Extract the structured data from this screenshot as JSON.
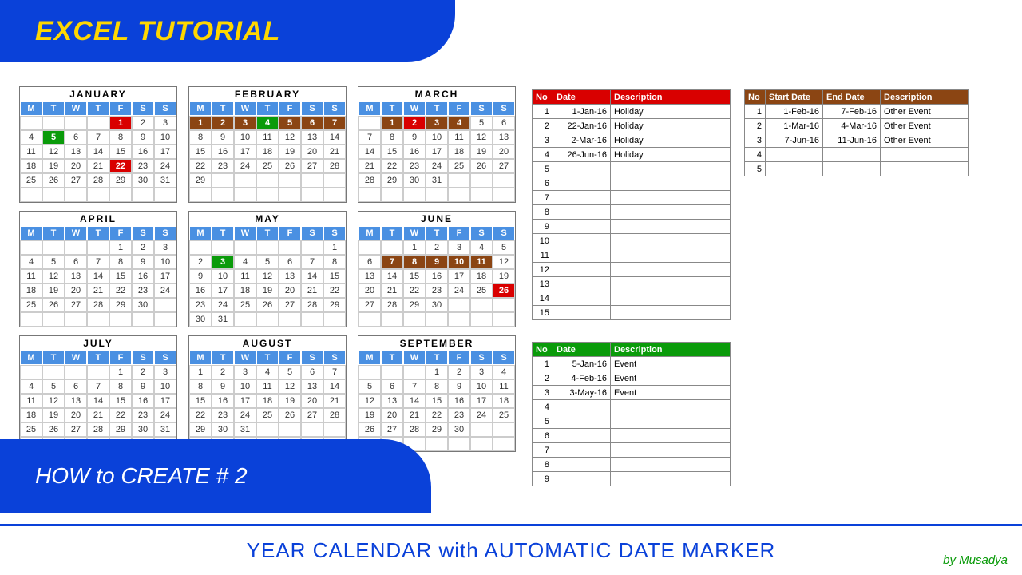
{
  "banner_title": "EXCEL TUTORIAL",
  "mid_title": "HOW to CREATE # 2",
  "footer_title": "YEAR CALENDAR with AUTOMATIC DATE MARKER",
  "author_text": "by Musadya",
  "dow": [
    "M",
    "T",
    "W",
    "T",
    "F",
    "S",
    "S"
  ],
  "months": [
    {
      "name": "JANUARY",
      "start": 4,
      "days": 31,
      "marks": {
        "1": "red",
        "5": "green",
        "22": "red"
      }
    },
    {
      "name": "FEBRUARY",
      "start": 0,
      "days": 29,
      "marks": {
        "1": "brown",
        "2": "brown",
        "3": "brown",
        "4": "green",
        "5": "brown",
        "6": "brown",
        "7": "brown"
      }
    },
    {
      "name": "MARCH",
      "start": 1,
      "days": 31,
      "marks": {
        "1": "brown",
        "2": "red",
        "3": "brown",
        "4": "brown"
      }
    },
    {
      "name": "APRIL",
      "start": 4,
      "days": 30,
      "marks": {}
    },
    {
      "name": "MAY",
      "start": 6,
      "days": 31,
      "marks": {
        "3": "green"
      }
    },
    {
      "name": "JUNE",
      "start": 2,
      "days": 30,
      "marks": {
        "7": "brown",
        "8": "brown",
        "9": "brown",
        "10": "brown",
        "11": "brown",
        "26": "red"
      }
    },
    {
      "name": "JULY",
      "start": 4,
      "days": 31,
      "marks": {}
    },
    {
      "name": "AUGUST",
      "start": 0,
      "days": 31,
      "marks": {}
    },
    {
      "name": "SEPTEMBER",
      "start": 3,
      "days": 30,
      "marks": {}
    }
  ],
  "holiday_table": {
    "headers": [
      "No",
      "Date",
      "Description"
    ],
    "rows": [
      [
        "1",
        "1-Jan-16",
        "Holiday"
      ],
      [
        "2",
        "22-Jan-16",
        "Holiday"
      ],
      [
        "3",
        "2-Mar-16",
        "Holiday"
      ],
      [
        "4",
        "26-Jun-16",
        "Holiday"
      ],
      [
        "5",
        "",
        ""
      ],
      [
        "6",
        "",
        ""
      ],
      [
        "7",
        "",
        ""
      ],
      [
        "8",
        "",
        ""
      ],
      [
        "9",
        "",
        ""
      ],
      [
        "10",
        "",
        ""
      ],
      [
        "11",
        "",
        ""
      ],
      [
        "12",
        "",
        ""
      ],
      [
        "13",
        "",
        ""
      ],
      [
        "14",
        "",
        ""
      ],
      [
        "15",
        "",
        ""
      ]
    ]
  },
  "event_table": {
    "headers": [
      "No",
      "Date",
      "Description"
    ],
    "rows": [
      [
        "1",
        "5-Jan-16",
        "Event"
      ],
      [
        "2",
        "4-Feb-16",
        "Event"
      ],
      [
        "3",
        "3-May-16",
        "Event"
      ],
      [
        "4",
        "",
        ""
      ],
      [
        "5",
        "",
        ""
      ],
      [
        "6",
        "",
        ""
      ],
      [
        "7",
        "",
        ""
      ],
      [
        "8",
        "",
        ""
      ],
      [
        "9",
        "",
        ""
      ]
    ]
  },
  "range_table": {
    "headers": [
      "No",
      "Start Date",
      "End Date",
      "Description"
    ],
    "rows": [
      [
        "1",
        "1-Feb-16",
        "7-Feb-16",
        "Other Event"
      ],
      [
        "2",
        "1-Mar-16",
        "4-Mar-16",
        "Other Event"
      ],
      [
        "3",
        "7-Jun-16",
        "11-Jun-16",
        "Other Event"
      ],
      [
        "4",
        "",
        "",
        ""
      ],
      [
        "5",
        "",
        "",
        ""
      ]
    ]
  }
}
